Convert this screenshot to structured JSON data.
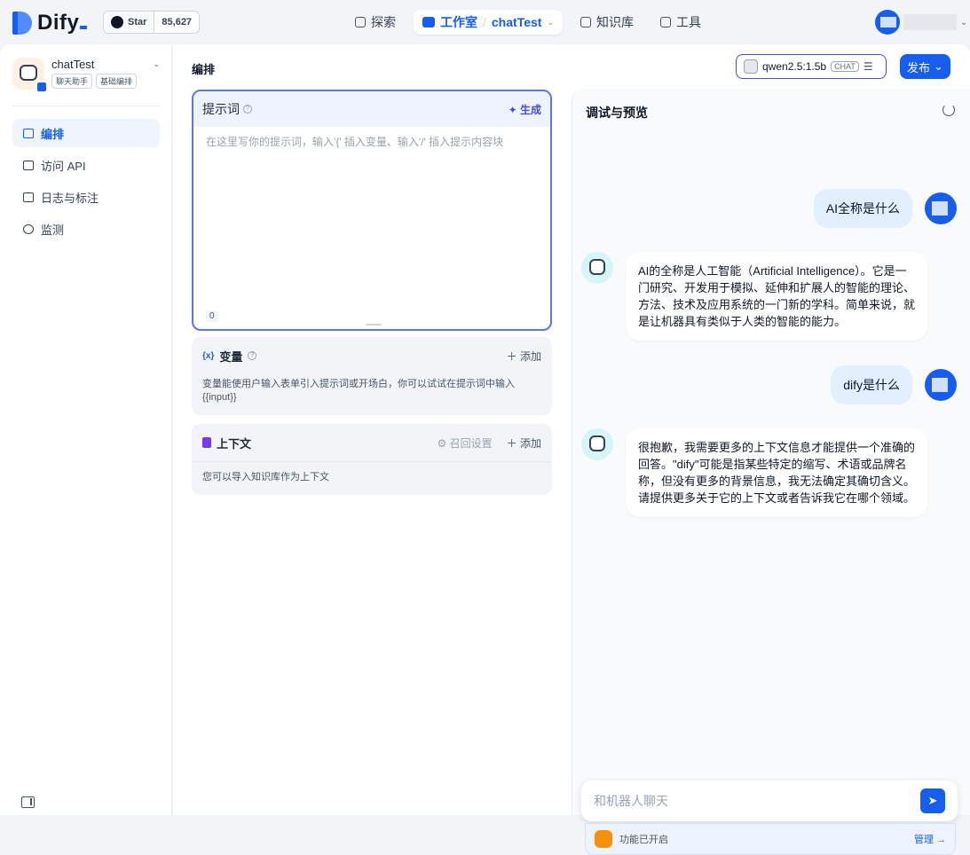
{
  "brand": {
    "name": "Dify"
  },
  "github": {
    "label": "Star",
    "count": "85,627"
  },
  "nav": {
    "explore": "探索",
    "studio": "工作室",
    "separator": "/",
    "app": "chatTest",
    "knowledge": "知识库",
    "tools": "工具"
  },
  "sidebar": {
    "app_name": "chatTest",
    "tags": [
      "聊天助手",
      "基础编排"
    ],
    "items": [
      {
        "label": "编排",
        "icon": "layout-icon"
      },
      {
        "label": "访问 API",
        "icon": "terminal-icon"
      },
      {
        "label": "日志与标注",
        "icon": "log-icon"
      },
      {
        "label": "监测",
        "icon": "gauge-icon"
      }
    ]
  },
  "main": {
    "heading": "编排",
    "model_name": "qwen2.5:1.5b",
    "model_tag": "CHAT",
    "publish": "发布"
  },
  "prompt": {
    "label": "提示词",
    "generate": "生成",
    "placeholder": "在这里写你的提示词，输入'{' 插入变量、输入'/' 插入提示内容块",
    "count": "0"
  },
  "variables": {
    "icon": "{x}",
    "label": "变量",
    "add": "添加",
    "desc": "变量能使用户输入表单引入提示词或开场白，你可以试试在提示词中输入 {{input}}"
  },
  "context": {
    "label": "上下文",
    "retrieval": "召回设置",
    "add": "添加",
    "desc": "您可以导入知识库作为上下文"
  },
  "debug": {
    "title": "调试与预览",
    "messages": [
      {
        "role": "user",
        "text": "AI全称是什么"
      },
      {
        "role": "bot",
        "text": "AI的全称是人工智能（Artificial Intelligence）。它是一门研究、开发用于模拟、延伸和扩展人的智能的理论、方法、技术及应用系统的一门新的学科。简单来说，就是让机器具有类似于人类的智能的能力。"
      },
      {
        "role": "user",
        "text": "dify是什么"
      },
      {
        "role": "bot",
        "text": "很抱歉，我需要更多的上下文信息才能提供一个准确的回答。\"dify\"可能是指某些特定的缩写、术语或品牌名称，但没有更多的背景信息，我无法确定其确切含义。请提供更多关于它的上下文或者告诉我它在哪个领域。"
      }
    ],
    "input_placeholder": "和机器人聊天",
    "features": "功能已开启",
    "manage": "管理 →"
  }
}
